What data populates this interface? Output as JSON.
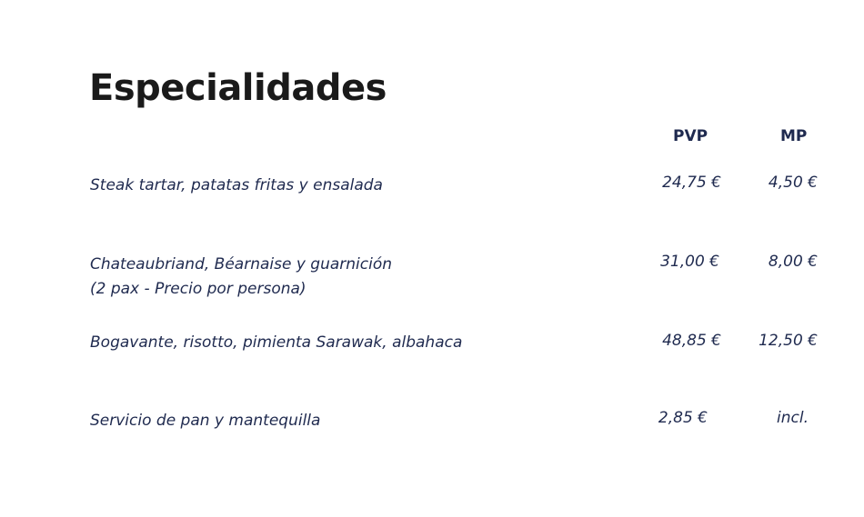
{
  "title": "Especialidades",
  "columns": {
    "pvp": "PVP",
    "mp": "MP"
  },
  "items": [
    {
      "name": "Steak tartar, patatas fritas y ensalada",
      "note": null,
      "pvp": "24,75 €",
      "mp": "4,50 €"
    },
    {
      "name": "Chateaubriand, Béarnaise y guarnición",
      "note": "(2 pax - Precio por persona)",
      "pvp": "31,00 €",
      "mp": "8,00 €"
    },
    {
      "name": "Bogavante, risotto, pimienta Sarawak, albahaca",
      "note": null,
      "pvp": "48,85 €",
      "mp": "12,50 €"
    },
    {
      "name": "Servicio de pan y mantequilla",
      "note": null,
      "pvp": "2,85 €",
      "mp": "incl."
    }
  ]
}
